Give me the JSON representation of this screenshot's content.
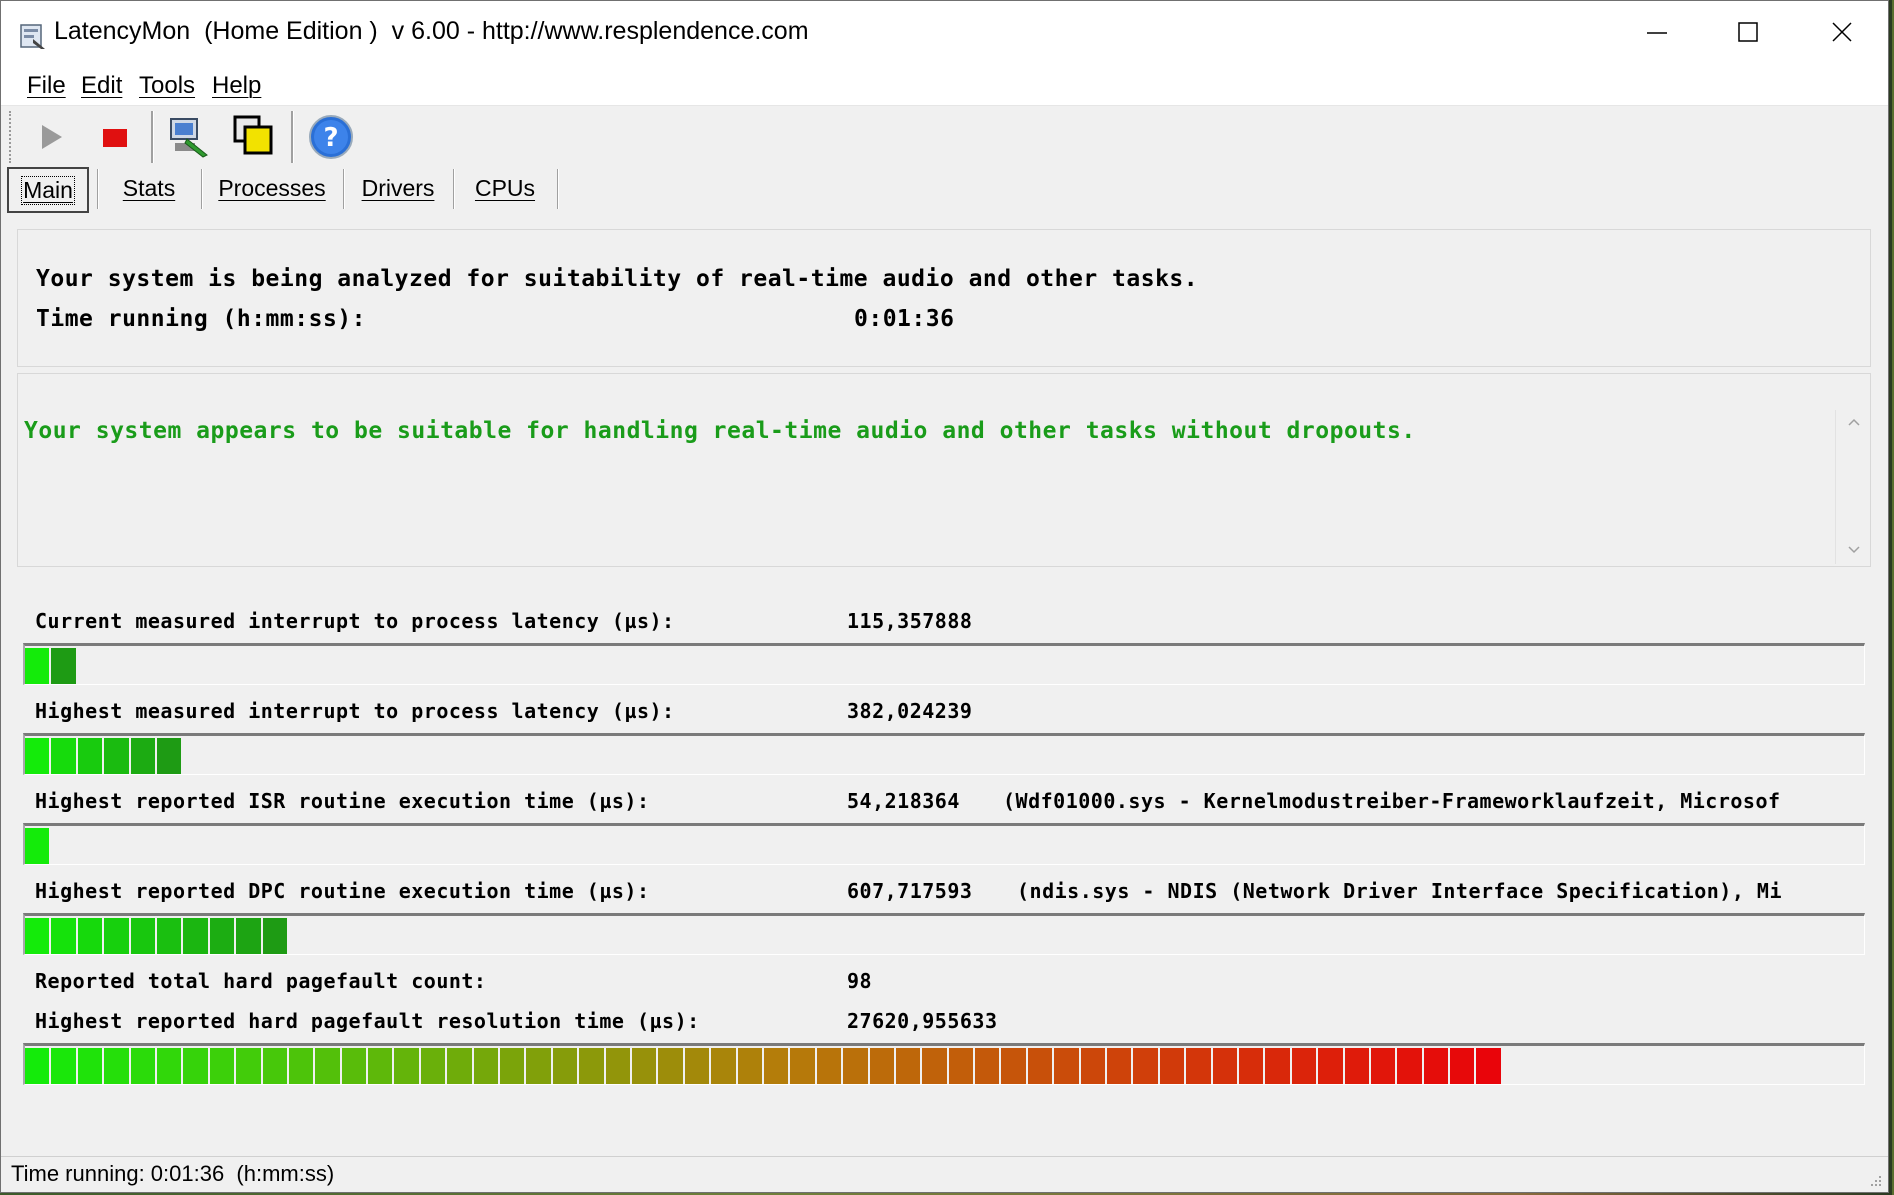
{
  "window": {
    "title": "LatencyMon  (Home Edition )  v 6.00 - http://www.resplendence.com"
  },
  "menu": {
    "items": [
      {
        "label": "File"
      },
      {
        "label": "Edit"
      },
      {
        "label": "Tools"
      },
      {
        "label": "Help"
      }
    ]
  },
  "toolbar": {
    "buttons": [
      {
        "icon": "play-icon",
        "enabled": false
      },
      {
        "icon": "stop-icon",
        "enabled": true
      },
      {
        "icon": "computer-drivers-icon",
        "enabled": true
      },
      {
        "icon": "windows-icon",
        "enabled": true
      },
      {
        "icon": "help-icon",
        "enabled": true
      }
    ]
  },
  "tabs": [
    {
      "label": "Main",
      "active": true
    },
    {
      "label": "Stats",
      "active": false
    },
    {
      "label": "Processes",
      "active": false
    },
    {
      "label": "Drivers",
      "active": false
    },
    {
      "label": "CPUs",
      "active": false
    }
  ],
  "analysis": {
    "line1": "Your system is being analyzed for suitability of real-time audio and other tasks.",
    "time_label": "Time running (h:mm:ss):",
    "time_value": "0:01:36"
  },
  "verdict": {
    "text": "Your system appears to be suitable for handling real-time audio and other tasks without dropouts.",
    "color": "#1a9c1a"
  },
  "metrics": {
    "current_latency": {
      "label": "Current measured interrupt to process latency (µs):",
      "value": "115,357888",
      "segments_filled": 2
    },
    "highest_latency": {
      "label": "Highest measured interrupt to process latency (µs):",
      "value": "382,024239",
      "segments_filled": 6
    },
    "highest_isr": {
      "label": "Highest reported ISR routine execution time (µs):",
      "value": "54,218364",
      "driver": "(Wdf01000.sys - Kernelmodustreiber-Frameworklaufzeit, Microsof",
      "segments_filled": 1
    },
    "highest_dpc": {
      "label": "Highest reported DPC routine execution time (µs):",
      "value": "607,717593",
      "driver": "(ndis.sys - NDIS (Network Driver Interface Specification), Mi",
      "segments_filled": 10
    },
    "pagefault_count": {
      "label": "Reported total hard pagefault count:",
      "value": "98"
    },
    "pagefault_time": {
      "label": "Highest reported hard pagefault resolution time (µs):",
      "value": "27620,955633",
      "segments_filled": 56
    },
    "total_segments": 57
  },
  "statusbar": {
    "text": "Time running: 0:01:36  (h:mm:ss)"
  }
}
